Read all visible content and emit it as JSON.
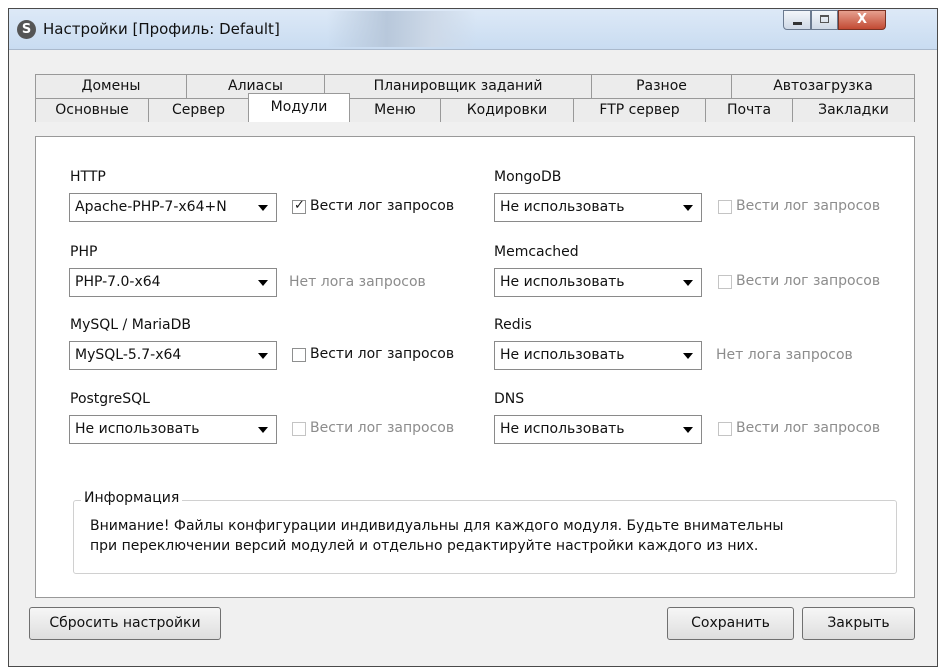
{
  "window": {
    "app_icon": "S",
    "title": "Настройки [Профиль: Default]",
    "controls": {
      "minimize": "minimize-icon",
      "maximize": "maximize-icon",
      "close_symbol": "X"
    }
  },
  "tabs": {
    "row_top": [
      "Домены",
      "Алиасы",
      "Планировщик заданий",
      "Разное",
      "Автозагрузка"
    ],
    "row_bottom": [
      "Основные",
      "Сервер",
      "Модули",
      "Меню",
      "Кодировки",
      "FTP сервер",
      "Почта",
      "Закладки"
    ],
    "active": "Модули"
  },
  "modules": {
    "http": {
      "label": "HTTP",
      "value": "Apache-PHP-7-x64+N",
      "log_label": "Вести лог запросов",
      "log_checked": true,
      "log_enabled": true
    },
    "php": {
      "label": "PHP",
      "value": "PHP-7.0-x64",
      "no_log_text": "Нет лога запросов"
    },
    "mysql": {
      "label": "MySQL / MariaDB",
      "value": "MySQL-5.7-x64",
      "log_label": "Вести лог запросов",
      "log_checked": false,
      "log_enabled": true
    },
    "postgresql": {
      "label": "PostgreSQL",
      "value": "Не использовать",
      "log_label": "Вести лог запросов",
      "log_checked": false,
      "log_enabled": false
    },
    "mongodb": {
      "label": "MongoDB",
      "value": "Не использовать",
      "log_label": "Вести лог запросов",
      "log_checked": false,
      "log_enabled": false
    },
    "memcached": {
      "label": "Memcached",
      "value": "Не использовать",
      "log_label": "Вести лог запросов",
      "log_checked": false,
      "log_enabled": false
    },
    "redis": {
      "label": "Redis",
      "value": "Не использовать",
      "no_log_text": "Нет лога запросов"
    },
    "dns": {
      "label": "DNS",
      "value": "Не использовать",
      "log_label": "Вести лог запросов",
      "log_checked": false,
      "log_enabled": false
    }
  },
  "info": {
    "legend": "Информация",
    "line1": "Внимание! Файлы конфигурации индивидуальны для каждого модуля. Будьте внимательны",
    "line2": "при переключении версий модулей и отдельно редактируйте настройки каждого из них."
  },
  "buttons": {
    "reset": "Сбросить настройки",
    "save": "Сохранить",
    "close": "Закрыть"
  }
}
